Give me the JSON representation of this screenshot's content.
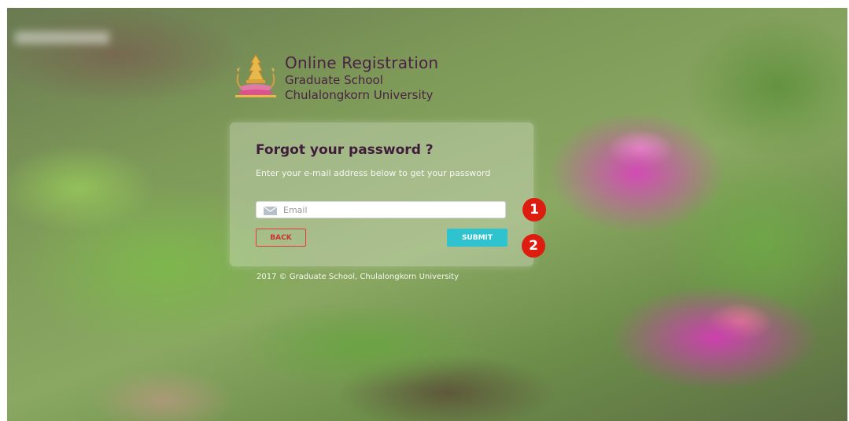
{
  "header": {
    "title": "Online Registration",
    "subtitle_line1": "Graduate School",
    "subtitle_line2": "Chulalongkorn University",
    "logo_icon": "university-crest-icon"
  },
  "form": {
    "heading": "Forgot your password ?",
    "description": "Enter your e-mail address below to get your password",
    "email": {
      "placeholder": "Email",
      "value": "",
      "icon": "envelope-icon"
    },
    "back_label": "BACK",
    "submit_label": "SUBMIT"
  },
  "footer": {
    "copyright": "2017 © Graduate School, Chulalongkorn University"
  },
  "annotations": {
    "marker1": "1",
    "marker2": "2"
  },
  "colors": {
    "title_text": "#4a2244",
    "back_button_border": "#e23b3b",
    "submit_button_bg": "#2ec3cf",
    "marker_bg": "#dd1d10"
  }
}
